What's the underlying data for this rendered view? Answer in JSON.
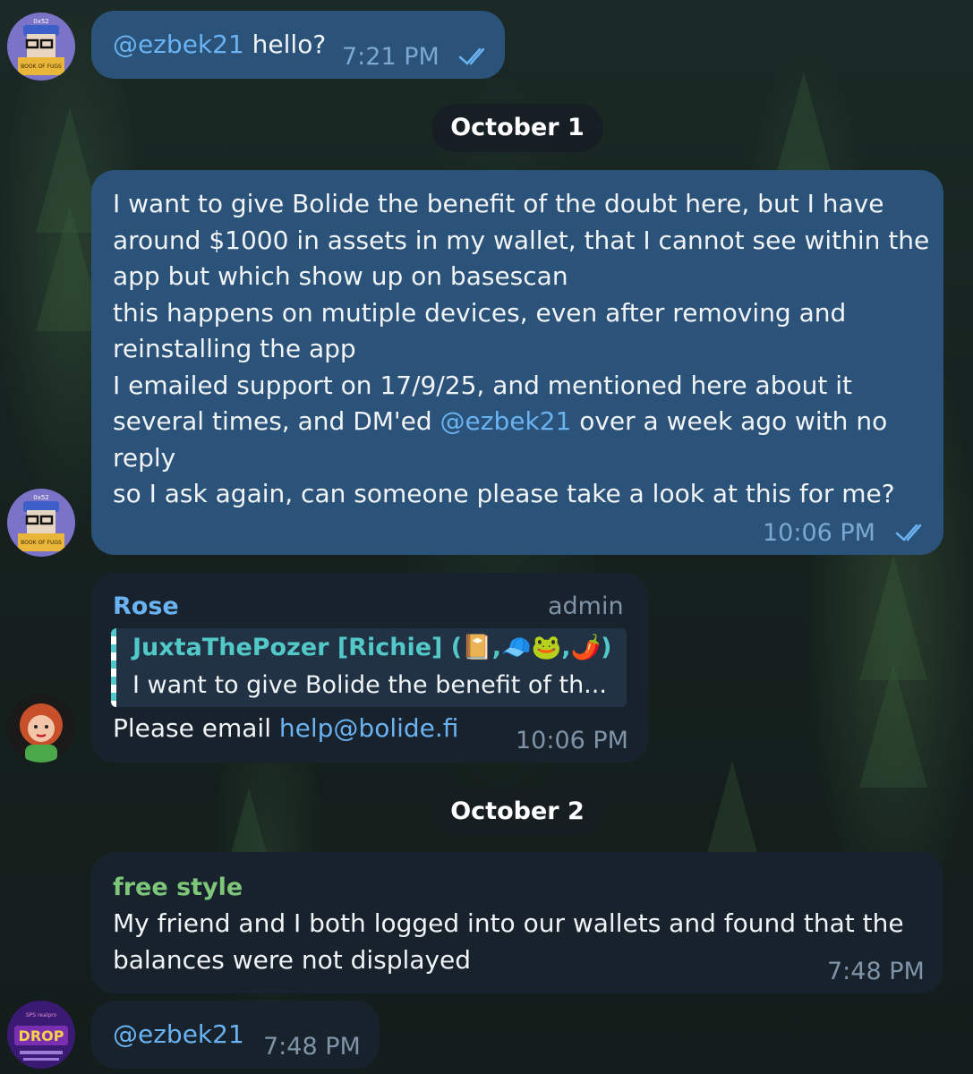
{
  "messages": {
    "m1": {
      "mention": "@ezbek21",
      "text": " hello?",
      "time": "7:21 PM"
    },
    "date1": "October 1",
    "m2": {
      "lines": [
        "I want to give Bolide the benefit of the doubt here, but I have",
        "around $1000 in assets in my wallet, that I cannot see within the",
        "app but which show up on basescan",
        "this happens on mutiple devices, even after removing and",
        "reinstalling the app",
        "I emailed support on 17/9/25, and mentioned here about it",
        "several times, and DM'ed ",
        "@ezbek21",
        " over a week ago with no",
        "reply",
        "so I ask again, can someone please take a look at this for me?"
      ],
      "time": "10:06 PM"
    },
    "m3": {
      "sender": "Rose",
      "role": "admin",
      "reply_sender": "JuxtaThePozer [Richie] (",
      "reply_emojis": [
        "📔",
        ",",
        "🧢",
        "🐸",
        ",",
        "🌶️",
        ")"
      ],
      "reply_text": "I want to give Bolide the benefit of th...",
      "text": "Please email ",
      "link": "help@bolide.fi",
      "time": "10:06 PM"
    },
    "date2": "October 2",
    "m4": {
      "sender": "free style",
      "lines": [
        "My friend and I both logged into our wallets and found that the",
        "balances were not displayed"
      ],
      "time": "7:48 PM"
    },
    "m5": {
      "mention": "@ezbek21",
      "time": "7:48 PM"
    }
  },
  "avatars": {
    "a1_label": "0x52",
    "a1_book": "BOOK OF FUGS",
    "a5_top": "SPS realpro",
    "a5_title": "DROP"
  },
  "colors": {
    "outgoing_bubble": "#2b5278",
    "incoming_bubble": "#18222d",
    "link": "#6ab3f3",
    "rose_name": "#6ab3f3",
    "free_style_name": "#7ec77a",
    "reply_name": "#53c8c8"
  }
}
